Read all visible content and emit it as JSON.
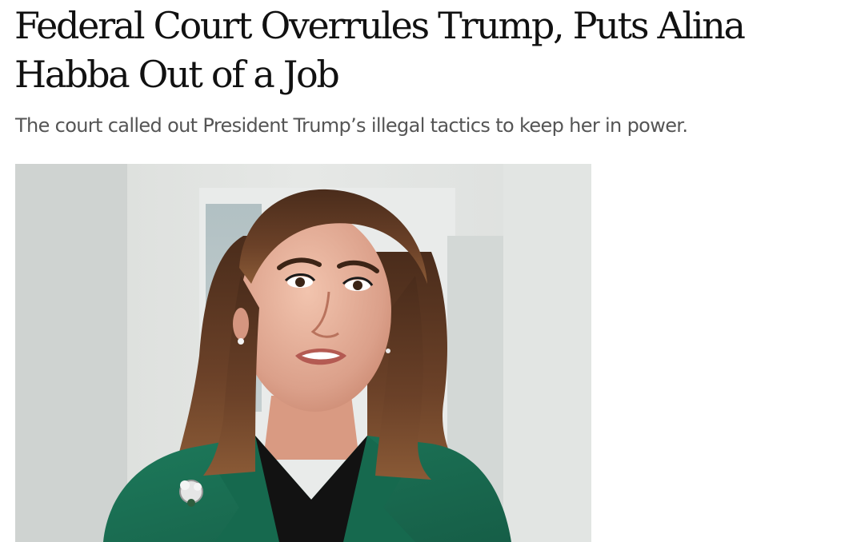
{
  "article": {
    "headline": "Federal Court Overrules Trump, Puts Alina Habba Out of a Job",
    "dek": "The court called out President Trump’s illegal tactics to keep her in power."
  },
  "hero_image": {
    "subject": "woman-in-green-blazer-portrait"
  },
  "colors": {
    "headline": "#111111",
    "dek": "#555555",
    "blazer": "#1f7a5c",
    "hair": "#5e3a24",
    "background": "#dfe1df"
  }
}
